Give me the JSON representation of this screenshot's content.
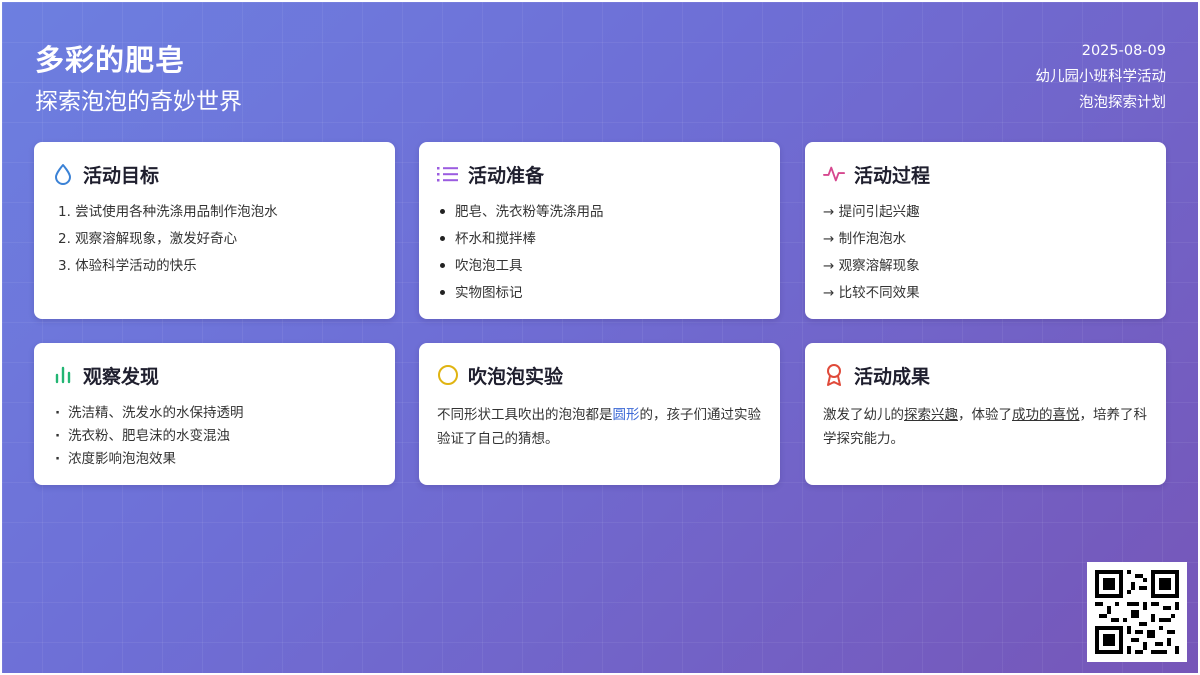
{
  "header": {
    "title": "多彩的肥皂",
    "subtitle": "探索泡泡的奇妙世界",
    "date": "2025-08-09",
    "class_info": "幼儿园小班科学活动",
    "plan_name": "泡泡探索计划"
  },
  "cards": {
    "goals": {
      "icon": "droplet-icon",
      "title": "活动目标",
      "items": [
        "1. 尝试使用各种洗涤用品制作泡泡水",
        "2. 观察溶解现象，激发好奇心",
        "3. 体验科学活动的快乐"
      ]
    },
    "prep": {
      "icon": "list-icon",
      "title": "活动准备",
      "items": [
        "肥皂、洗衣粉等洗涤用品",
        "杯水和搅拌棒",
        "吹泡泡工具",
        "实物图标记"
      ]
    },
    "process": {
      "icon": "pulse-icon",
      "title": "活动过程",
      "items": [
        "→ 提问引起兴趣",
        "→ 制作泡泡水",
        "→ 观察溶解现象",
        "→ 比较不同效果"
      ]
    },
    "findings": {
      "icon": "bar-chart-icon",
      "title": "观察发现",
      "items": [
        "洗洁精、洗发水的水保持透明",
        "洗衣粉、肥皂沫的水变混浊",
        "浓度影响泡泡效果"
      ]
    },
    "experiment": {
      "icon": "circle-icon",
      "title": "吹泡泡实验",
      "text_before": "不同形状工具吹出的泡泡都是",
      "highlight": "圆形",
      "text_after": "的，孩子们通过实验验证了自己的猜想。"
    },
    "results": {
      "icon": "award-icon",
      "title": "活动成果",
      "t1": "激发了幼儿的",
      "u1": "探索兴趣",
      "t2": "，体验了",
      "u2": "成功的喜悦",
      "t3": "，培养了科学探究能力。"
    }
  },
  "colors": {
    "background_start": "#6d7fe0",
    "background_end": "#7656b8",
    "goals_icon": "#3b82d6",
    "prep_icon": "#9b5ce0",
    "process_icon": "#d6478f",
    "findings_icon": "#22b573",
    "experiment_icon": "#e0b412",
    "results_icon": "#e04a3a",
    "highlight": "#3b68d6"
  },
  "qr_code": {
    "icon": "qr-code-icon"
  }
}
